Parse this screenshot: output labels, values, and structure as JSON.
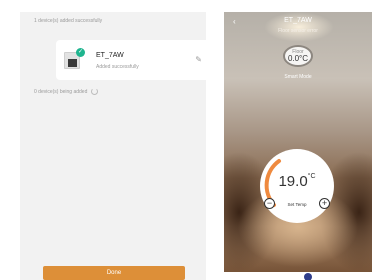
{
  "left": {
    "added_header": "1 device(s) added successfully",
    "device": {
      "name": "ET_7AW",
      "status": "Added successfully"
    },
    "being_added": "0 device(s) being added",
    "done_label": "Done"
  },
  "right": {
    "title": "ET_7AW",
    "sensor_error": "Floor sensor error",
    "floor": {
      "label": "Floor",
      "value": "0.0°C"
    },
    "mode": "Smart Mode",
    "dial": {
      "temperature": "19.0",
      "unit": "°C",
      "set_label": "Set Temp",
      "minus_symbol": "−",
      "plus_symbol": "+"
    }
  },
  "colors": {
    "accent": "#dd8f38",
    "success": "#1fb58f",
    "dial_arc": "#ef8a3f",
    "nav_dot": "#2f3d8a"
  }
}
